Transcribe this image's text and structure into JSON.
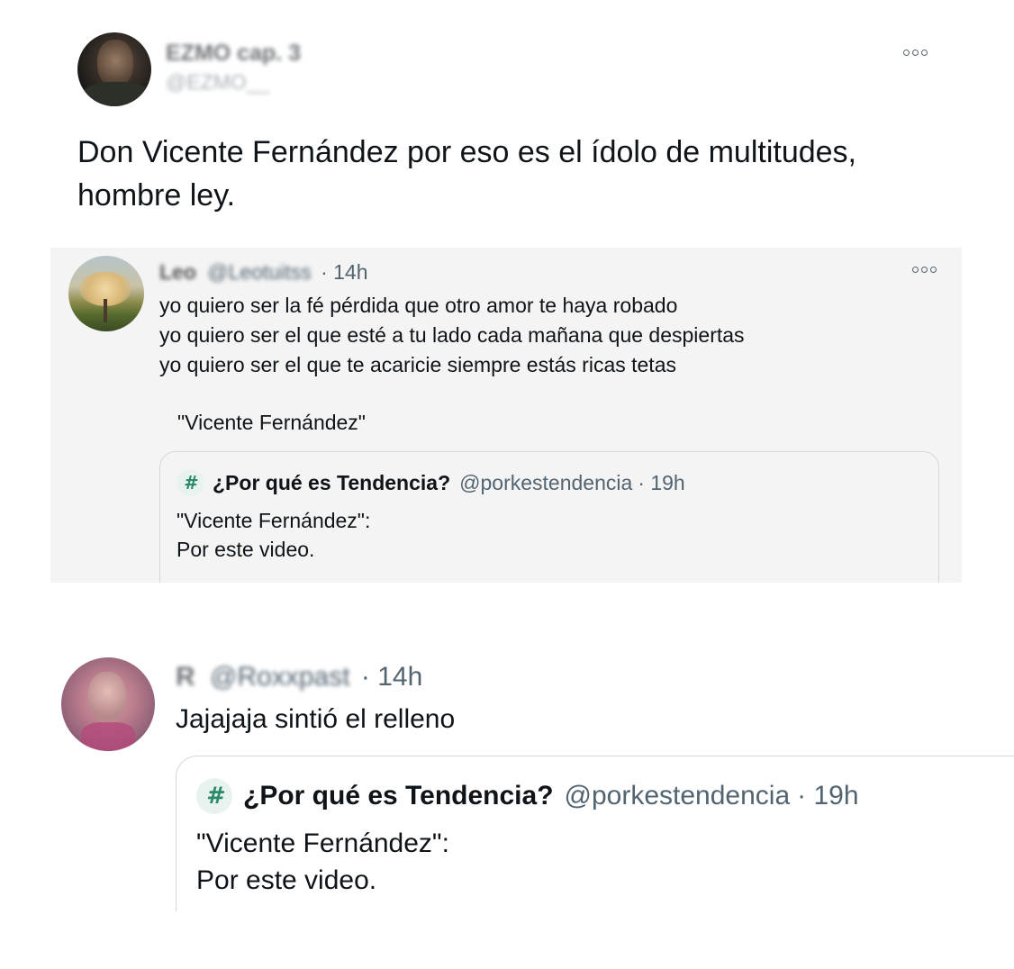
{
  "main_tweet": {
    "display_name": "EZMO cap. 3",
    "handle": "@EZMO__",
    "text_line1": "Don Vicente Fernández por eso es el ídolo de multitudes,",
    "text_line2": "hombre ley."
  },
  "quoted_tweet": {
    "display_name": "Leo",
    "handle": "@Leotuitss",
    "time": "· 14h",
    "lines": [
      "yo quiero ser la fé pérdida que otro amor te haya robado",
      "yo quiero ser el que esté a tu lado cada mañana que despiertas",
      "yo quiero ser el que te acaricie siempre estás ricas tetas"
    ],
    "attribution": "\"Vicente Fernández\"",
    "nested_quote": {
      "display_name": "¿Por qué es Tendencia?",
      "handle": "@porkestendencia",
      "time": "· 19h",
      "line1": "\"Vicente Fernández\":",
      "line2": "Por este video."
    }
  },
  "reply_tweet": {
    "display_name": "R",
    "handle": "@Roxxpast",
    "time": "· 14h",
    "text": "Jajajaja sintió el relleno",
    "quote": {
      "display_name": "¿Por qué es Tendencia?",
      "handle": "@porkestendencia",
      "time": "· 19h",
      "line1": "\"Vicente Fernández\":",
      "line2": "Por este video."
    }
  },
  "icons": {
    "more": "more-options-icon",
    "hash": "hashtag-logo-icon"
  },
  "colors": {
    "text": "#0f1419",
    "muted": "#536471",
    "quote_bg": "#f4f4f4",
    "border": "#cfd9de"
  }
}
